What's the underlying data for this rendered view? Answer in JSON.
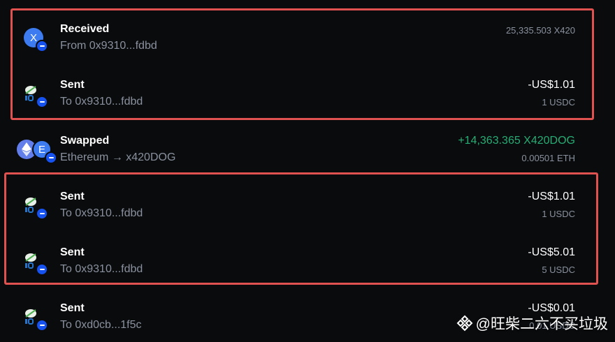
{
  "transactions": [
    {
      "title": "Received",
      "subtitle": "From 0x9310...fdbd",
      "amount_primary": "",
      "amount_secondary": "25,335.503 X420",
      "asset_icon": "x420-token-icon",
      "asset_letter": "X"
    },
    {
      "title": "Sent",
      "subtitle": "To 0x9310...fdbd",
      "amount_primary": "-US$1.01",
      "amount_secondary": "1 USDC",
      "asset_icon": "usdc-token-icon"
    },
    {
      "title": "Swapped",
      "subtitle": "Ethereum → x420DOG",
      "amount_primary": "+14,363.365 X420DOG",
      "amount_secondary": "0.00501 ETH",
      "asset_icon": "eth-to-x420dog-swap-icon",
      "asset_letter": "E"
    },
    {
      "title": "Sent",
      "subtitle": "To 0x9310...fdbd",
      "amount_primary": "-US$1.01",
      "amount_secondary": "1 USDC",
      "asset_icon": "usdc-token-icon"
    },
    {
      "title": "Sent",
      "subtitle": "To 0x9310...fdbd",
      "amount_primary": "-US$5.01",
      "amount_secondary": "5 USDC",
      "asset_icon": "usdc-token-icon"
    },
    {
      "title": "Sent",
      "subtitle": "To 0xd0cb...1f5c",
      "amount_primary": "-US$0.01",
      "amount_secondary": "0.01 USDC",
      "asset_icon": "usdc-token-icon"
    }
  ],
  "watermark": {
    "text": "@旺柴二六不买垃圾"
  },
  "colors": {
    "background": "#0a0b0d",
    "highlight": "#e0524f",
    "positive": "#27ad75",
    "badge": "#1652f0",
    "muted": "#8a919e"
  }
}
